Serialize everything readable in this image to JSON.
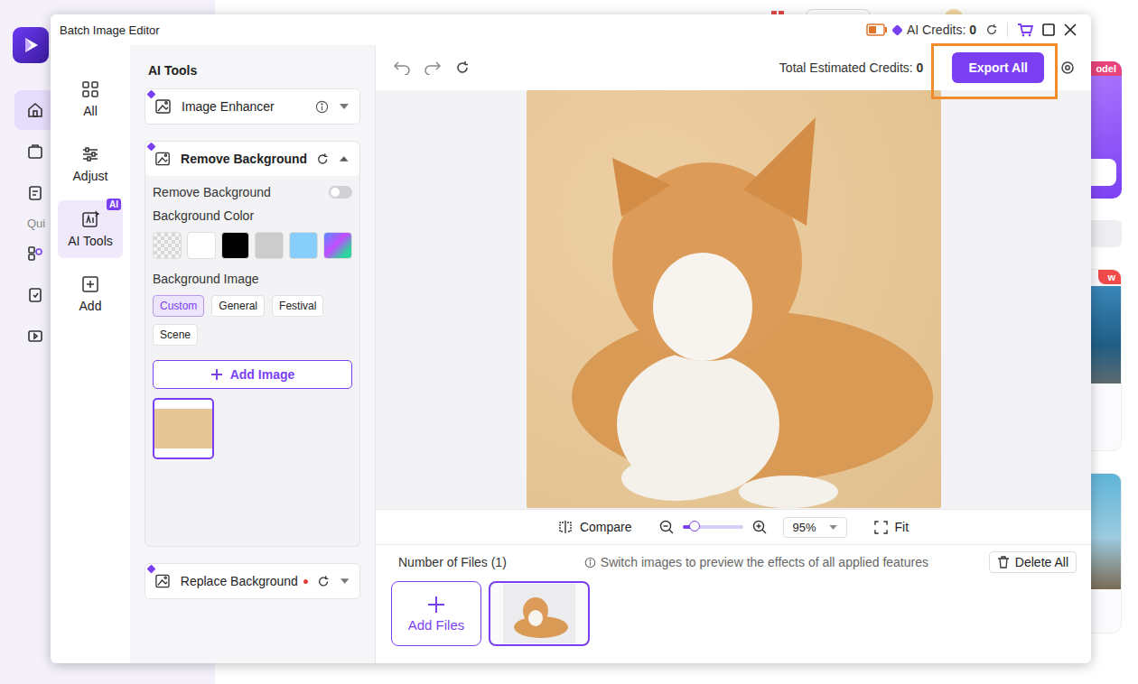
{
  "host": {
    "nav_icons": [
      {
        "selected": true
      },
      {
        "selected": false
      },
      {
        "selected": false
      }
    ],
    "section_label": "Qui",
    "quick_icons": [
      {
        "selected": false
      },
      {
        "selected": false
      },
      {
        "selected": false
      }
    ],
    "tags": [
      "odel",
      "w"
    ]
  },
  "window": {
    "title": "Batch Image Editor",
    "credits_label": "AI Credits:",
    "credits": "0"
  },
  "nav": [
    {
      "label": "All",
      "selected": false,
      "badge": ""
    },
    {
      "label": "Adjust",
      "selected": false,
      "badge": ""
    },
    {
      "label": "AI Tools",
      "selected": true,
      "badge": "AI"
    },
    {
      "label": "Add",
      "selected": false,
      "badge": ""
    }
  ],
  "panel": {
    "title": "AI Tools",
    "tools": [
      {
        "name": "Image Enhancer",
        "expanded": false,
        "info": true,
        "resettable": false,
        "new": false
      },
      {
        "name": "Remove Background",
        "expanded": true,
        "info": false,
        "resettable": true,
        "new": false
      },
      {
        "name": "Replace Background",
        "expanded": false,
        "info": false,
        "resettable": true,
        "new": true
      }
    ]
  },
  "remove_background": {
    "toggle_label": "Remove Background",
    "on": false,
    "color_label": "Background Color",
    "colors": [
      {
        "kind": "transparent",
        "selected": false
      },
      {
        "kind": "solid",
        "color": "#ffffff",
        "selected": false
      },
      {
        "kind": "solid",
        "color": "#000000",
        "selected": false
      },
      {
        "kind": "solid",
        "color": "#cccccc",
        "selected": false
      },
      {
        "kind": "solid",
        "color": "#87cefa",
        "selected": false
      },
      {
        "kind": "gradient",
        "selected": false
      }
    ],
    "image_label": "Background Image",
    "categories": [
      {
        "label": "Custom",
        "selected": true
      },
      {
        "label": "General",
        "selected": false
      },
      {
        "label": "Festival",
        "selected": false
      },
      {
        "label": "Scene",
        "selected": false
      }
    ],
    "add_image": "Add Image",
    "images": [
      {
        "selected": true
      }
    ]
  },
  "toolbar": {
    "credits_label": "Total Estimated Credits:",
    "credits": "0",
    "export": "Export All",
    "highlighted": true
  },
  "zoom": {
    "compare": "Compare",
    "level": 0.2,
    "value": "95%",
    "fit": "Fit"
  },
  "files": {
    "count_label": "Number of Files (1)",
    "hint": "Switch images to preview the effects of all applied features",
    "delete_all": "Delete All",
    "add_files": "Add Files",
    "items": [
      {
        "selected": true
      }
    ]
  }
}
